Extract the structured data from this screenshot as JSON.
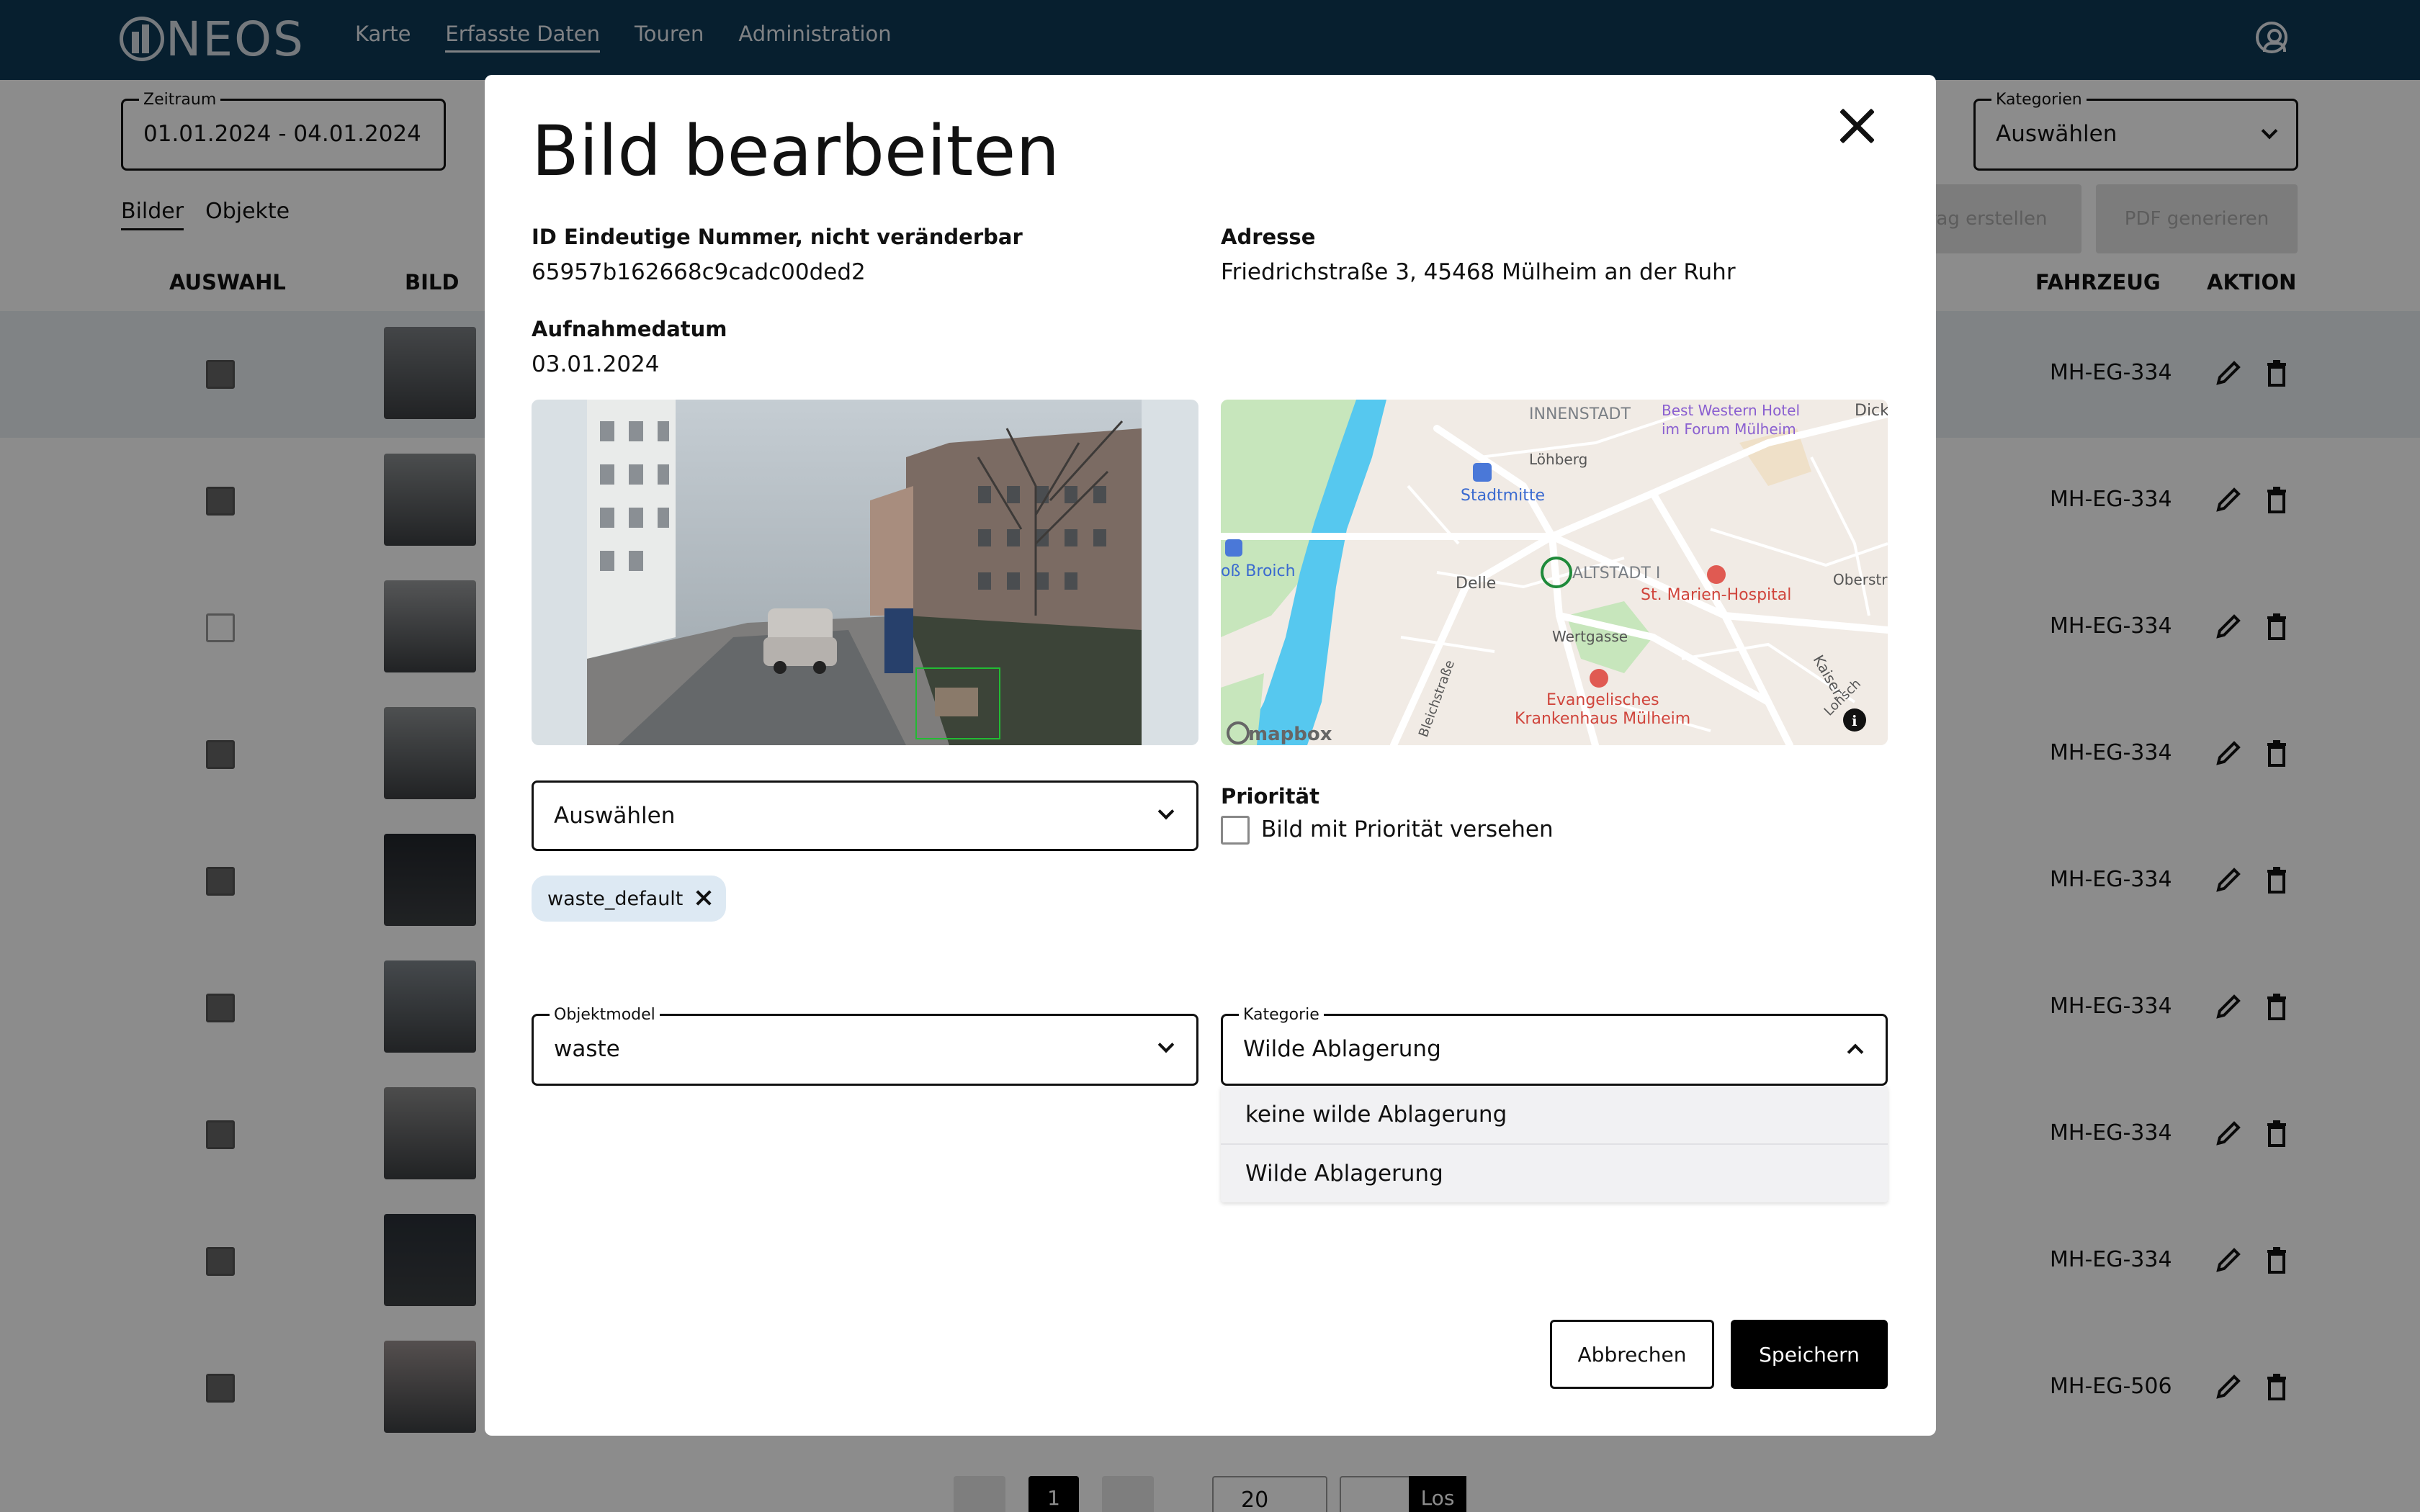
{
  "app": {
    "logo_text": "NEOS",
    "nav": [
      "Karte",
      "Erfasste Daten",
      "Touren",
      "Administration"
    ],
    "active_nav": "Erfasste Daten"
  },
  "filters": {
    "zeitraum_label": "Zeitraum",
    "zeitraum_value": "01.01.2024 - 04.01.2024",
    "kategorien_label": "Kategorien",
    "kategorien_value": "Auswählen"
  },
  "subtabs": [
    "Bilder",
    "Objekte"
  ],
  "actions": {
    "auftrag": "trag erstellen",
    "pdf": "PDF generieren"
  },
  "table": {
    "headers": {
      "auswahl": "AUSWAHL",
      "bild": "BILD",
      "fahrzeug": "FAHRZEUG",
      "aktion": "AKTION"
    },
    "rows": [
      {
        "vehicle": "MH-EG-334",
        "checked": true
      },
      {
        "vehicle": "MH-EG-334",
        "checked": true
      },
      {
        "vehicle": "MH-EG-334",
        "checked": false
      },
      {
        "vehicle": "MH-EG-334",
        "checked": true
      },
      {
        "vehicle": "MH-EG-334",
        "checked": true
      },
      {
        "vehicle": "MH-EG-334",
        "checked": true
      },
      {
        "vehicle": "MH-EG-334",
        "checked": true
      },
      {
        "vehicle": "MH-EG-334",
        "checked": true
      },
      {
        "vehicle": "MH-EG-506",
        "checked": true
      }
    ]
  },
  "pagination": {
    "page": "1",
    "page_size": "20",
    "go": "Los"
  },
  "modal": {
    "title": "Bild bearbeiten",
    "id_label": "ID Eindeutige Nummer, nicht veränderbar",
    "id_value": "65957b162668c9cadc00ded2",
    "adresse_label": "Adresse",
    "adresse_value": "Friedrichstraße 3, 45468 Mülheim an der Ruhr",
    "datum_label": "Aufnahmedatum",
    "datum_value": "03.01.2024",
    "map_labels": {
      "innenstadt": "INNENSTADT",
      "hotel_1": "Best Western Hotel",
      "hotel_2": "im Forum Mülheim",
      "dick": "Dick",
      "loehberg": "Löhberg",
      "stadtmitte": "Stadtmitte",
      "broich": "oß Broich",
      "altstadt": "ALTSTADT I",
      "delle": "Delle",
      "marien": "St. Marien-Hospital",
      "oberst": "Oberstr",
      "wertgasse": "Wertgasse",
      "evang_1": "Evangelisches",
      "evang_2": "Krankenhaus Mülheim",
      "bleich": "Bleichstraße",
      "kaiser": "Kaiser.",
      "lohsch": "Lohsch",
      "mapbox": "mapbox"
    },
    "select_placeholder": "Auswählen",
    "tag": "waste_default",
    "prioritaet_label": "Priorität",
    "prioritaet_checkbox": "Bild mit Priorität versehen",
    "objektmodel_label": "Objektmodel",
    "objektmodel_value": "waste",
    "kategorie_label": "Kategorie",
    "kategorie_value": "Wilde Ablagerung",
    "kategorie_options": [
      "keine wilde Ablagerung",
      "Wilde Ablagerung"
    ],
    "cancel": "Abbrechen",
    "save": "Speichern"
  },
  "colors": {
    "topbar": "#0e3a57",
    "map_water": "#56c8ef",
    "map_park": "#bfe3b4",
    "marker": "#1f8a3a"
  }
}
